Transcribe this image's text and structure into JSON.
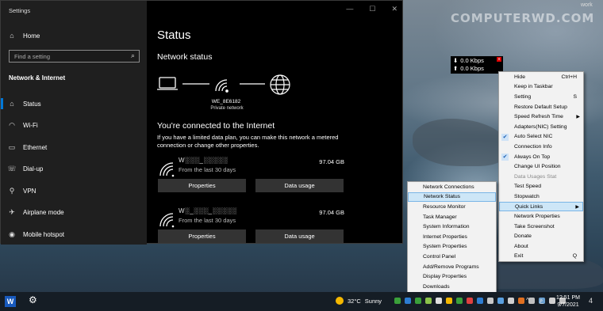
{
  "desktop": {
    "watermark": "COMPUTERWD.COM",
    "work_label": "work"
  },
  "window": {
    "title": "Settings",
    "controls": [
      "—",
      "☐",
      "✕"
    ],
    "search_placeholder": "Find a setting",
    "home_label": "Home",
    "section_label": "Network & Internet",
    "nav_items": [
      {
        "label": "Status",
        "icon": "home-status-icon"
      },
      {
        "label": "Wi-Fi",
        "icon": "wifi-icon"
      },
      {
        "label": "Ethernet",
        "icon": "ethernet-icon"
      },
      {
        "label": "Dial-up",
        "icon": "phone-icon"
      },
      {
        "label": "VPN",
        "icon": "vpn-icon"
      },
      {
        "label": "Airplane mode",
        "icon": "airplane-icon"
      },
      {
        "label": "Mobile hotspot",
        "icon": "hotspot-icon"
      }
    ]
  },
  "main": {
    "title": "Status",
    "network_status_heading": "Network status",
    "ssid": "WE_8E6182",
    "network_type": "Private network",
    "connected_text": "You're connected to the Internet",
    "limited_text": "If you have a limited data plan, you can make this network a metered connection or change other properties.",
    "connections": [
      {
        "name": "W░░░_░░░░░",
        "sub": "From the last 30 days",
        "size": "97.04 GB",
        "properties_label": "Properties",
        "usage_label": "Data usage"
      },
      {
        "name": "W░_░░░_░░░░░",
        "sub": "From the last 30 days",
        "size": "97.04 GB",
        "properties_label": "Properties",
        "usage_label": "Data usage"
      }
    ]
  },
  "speed_widget": {
    "down": "0.0 Kbps",
    "up": "0.0 Kbps",
    "close": "x"
  },
  "context_menu": [
    {
      "label": "Hide",
      "shortcut": "Ctrl+H"
    },
    {
      "label": "Keep in Taskbar"
    },
    {
      "label": "Setting",
      "shortcut": "S"
    },
    {
      "label": "Restore Default Setup"
    },
    {
      "label": "Speed Refresh Time",
      "submenu": true
    },
    {
      "label": "Adapters(NIC) Setting"
    },
    {
      "label": "Auto Select NIC",
      "checked": true
    },
    {
      "label": "Connection Info"
    },
    {
      "label": "Always On Top",
      "checked": true
    },
    {
      "label": "Change UI Position"
    },
    {
      "label": "Data Usages Stat",
      "disabled": true
    },
    {
      "label": "Test Speed"
    },
    {
      "label": "Stopwatch"
    },
    {
      "label": "Quick Links",
      "submenu": true,
      "selected": true
    },
    {
      "label": "Network Properties"
    },
    {
      "label": "Take Screenshot"
    },
    {
      "label": "Donate"
    },
    {
      "label": "About"
    },
    {
      "label": "Exit",
      "shortcut": "Q"
    }
  ],
  "quick_links": [
    {
      "label": "Network Connections"
    },
    {
      "label": "Network Status",
      "selected": true
    },
    {
      "label": "Resource Monitor"
    },
    {
      "label": "Task Manager"
    },
    {
      "label": "System Information"
    },
    {
      "label": "Internet Properties"
    },
    {
      "label": "System Properties"
    },
    {
      "label": "Control Panel"
    },
    {
      "label": "Add/Remove Programs"
    },
    {
      "label": "Display Properties"
    },
    {
      "label": "Downloads"
    }
  ],
  "taskbar": {
    "weather_temp": "32°C",
    "weather_text": "Sunny",
    "language": "ع",
    "time": "12:51 PM",
    "date": "9/7/2021",
    "notification_count": "4",
    "tray_colors": [
      "#3aa03a",
      "#2d7dd2",
      "#3aa03a",
      "#8bc34a",
      "#e0e0e0",
      "#f5b800",
      "#3aa03a",
      "#e04040",
      "#2d7dd2",
      "#c8c8c8",
      "#5aa0e0",
      "#d0d0d0",
      "#e07020",
      "#c0c0c0",
      "#6aa0d0",
      "#d0d0d0",
      "#c0c0c0"
    ]
  }
}
